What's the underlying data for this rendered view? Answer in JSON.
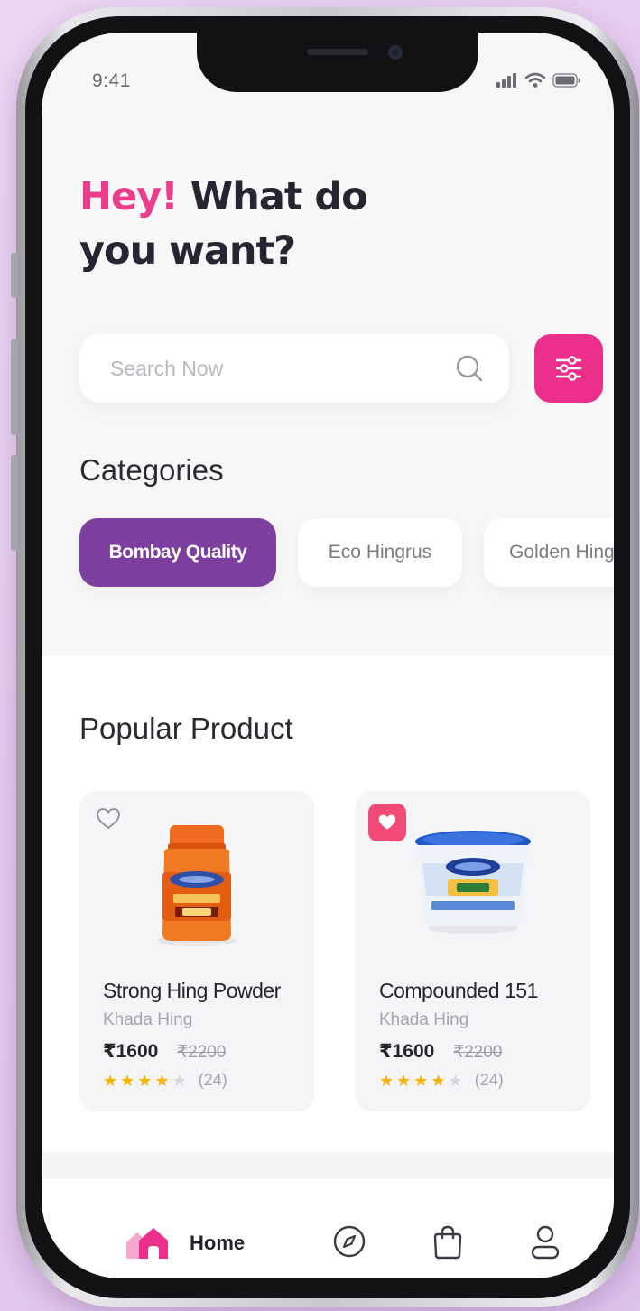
{
  "status_bar": {
    "time": "9:41"
  },
  "header": {
    "greeting": "Hey!",
    "question_line1": "What do",
    "question_line2": "you want?"
  },
  "search": {
    "placeholder": "Search Now"
  },
  "categories": {
    "title": "Categories",
    "items": [
      {
        "label": "Bombay Quality",
        "active": true
      },
      {
        "label": "Eco Hingrus",
        "active": false
      },
      {
        "label": "Golden Hing",
        "active": false
      }
    ]
  },
  "popular": {
    "title": "Popular Product",
    "products": [
      {
        "name": "Strong Hing Powder",
        "brand": "Khada Hing",
        "price": "₹1600",
        "old_price": "₹2200",
        "rating": 4,
        "reviews": "(24)",
        "favorited": false
      },
      {
        "name": "Compounded 151",
        "brand": "Khada Hing",
        "price": "₹1600",
        "old_price": "₹2200",
        "rating": 4,
        "reviews": "(24)",
        "favorited": true
      }
    ]
  },
  "bottom_nav": {
    "items": [
      {
        "label": "Home",
        "icon": "home-icon",
        "active": true
      },
      {
        "label": "",
        "icon": "compass-icon",
        "active": false
      },
      {
        "label": "",
        "icon": "shopping-bag-icon",
        "active": false
      },
      {
        "label": "",
        "icon": "user-icon",
        "active": false
      }
    ]
  },
  "colors": {
    "accent_pink": "#ec2f8b",
    "category_active": "#7c3fa0",
    "favorite_badge": "#f24a76",
    "star": "#f5b400",
    "star_empty": "#d6d6db"
  }
}
